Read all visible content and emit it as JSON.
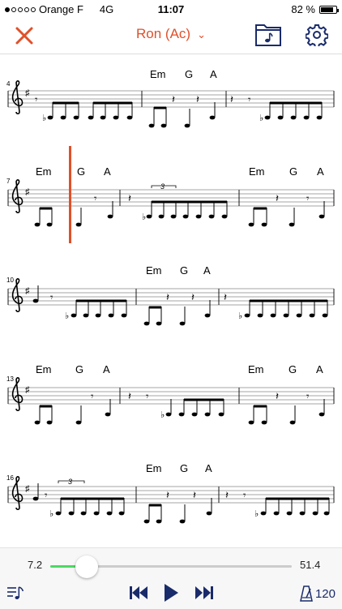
{
  "status_bar": {
    "carrier": "Orange F",
    "network": "4G",
    "time": "11:07",
    "battery": "82 %",
    "battery_level": 0.82,
    "signal_bars_filled": 1,
    "signal_bars_total": 5
  },
  "nav": {
    "title": "Ron (Ac)",
    "accent_color": "#e0502a",
    "icons": [
      "close-icon",
      "chevron-down-icon",
      "folder-music-icon",
      "gear-icon"
    ]
  },
  "score": {
    "systems": [
      {
        "measure_number": "4",
        "chords": [
          "Em",
          "G",
          "A"
        ]
      },
      {
        "measure_number": "7",
        "chords": [
          "Em",
          "G",
          "A",
          "Em",
          "G",
          "A"
        ]
      },
      {
        "measure_number": "10",
        "chords": [
          "Em",
          "G",
          "A"
        ]
      },
      {
        "measure_number": "13",
        "chords": [
          "Em",
          "G",
          "A",
          "Em",
          "G",
          "A"
        ]
      },
      {
        "measure_number": "16",
        "chords": [
          "Em",
          "G",
          "A"
        ]
      }
    ],
    "triplet_label": "3",
    "cursor_color": "#e0502a"
  },
  "player": {
    "start_time": "7.2",
    "end_time": "51.4",
    "progress": 0.15,
    "tempo": "120",
    "icons": [
      "playlist-icon",
      "skip-back-icon",
      "play-icon",
      "skip-forward-icon",
      "metronome-icon"
    ]
  }
}
